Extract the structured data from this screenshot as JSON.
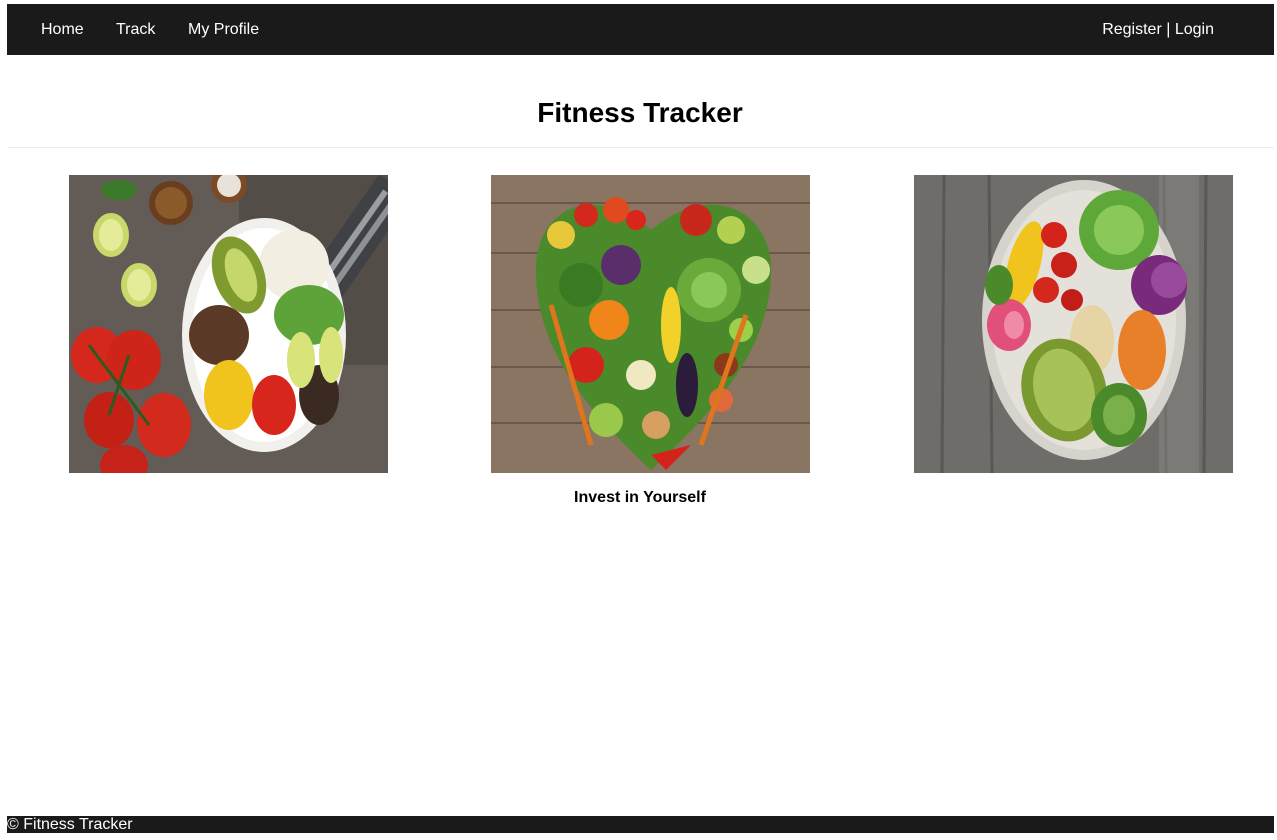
{
  "nav": {
    "home": "Home",
    "track": "Track",
    "profile": "My Profile",
    "register": "Register",
    "separator": "|",
    "login": "Login"
  },
  "main": {
    "title": "Fitness Tracker",
    "caption": "Invest in Yourself",
    "images": [
      {
        "name": "salad-bowl-with-tomatoes-image"
      },
      {
        "name": "vegetable-heart-image"
      },
      {
        "name": "buddha-bowl-image"
      }
    ]
  },
  "footer": {
    "text": "© Fitness Tracker"
  },
  "colors": {
    "nav_bg": "#1a1a1a",
    "nav_text": "#ffffff",
    "page_bg": "#ffffff"
  }
}
